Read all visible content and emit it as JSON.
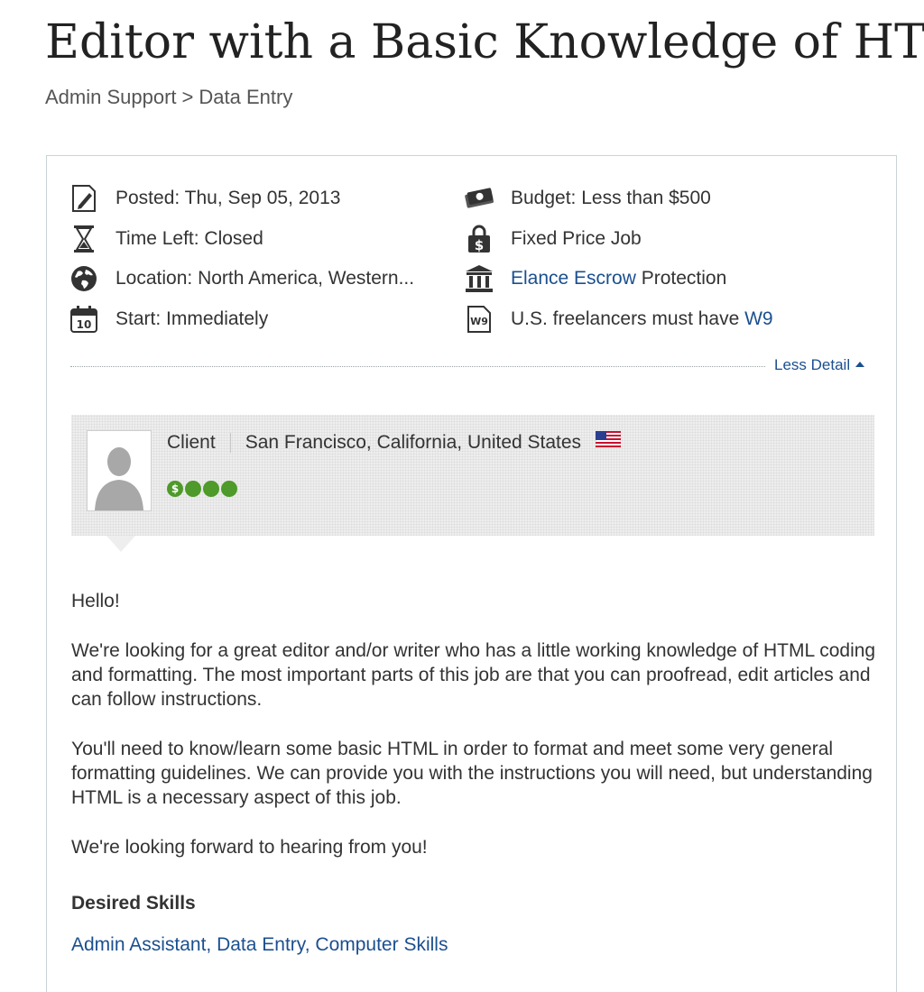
{
  "job": {
    "title": "Editor with a Basic Knowledge of HTML",
    "breadcrumb": {
      "category": "Admin Support",
      "separator": ">",
      "subcategory": "Data Entry"
    }
  },
  "meta": {
    "posted": {
      "icon": "pencil-paper-icon",
      "text": "Posted: Thu, Sep 05, 2013"
    },
    "time_left": {
      "icon": "hourglass-icon",
      "text": "Time Left: Closed"
    },
    "location": {
      "icon": "globe-icon",
      "text": "Location: North America, Western..."
    },
    "start": {
      "icon": "calendar-icon",
      "calendar_day": "10",
      "text": "Start: Immediately"
    },
    "budget": {
      "icon": "money-icon",
      "text": "Budget: Less than $500"
    },
    "job_type": {
      "icon": "money-lock-icon",
      "text": "Fixed Price Job"
    },
    "escrow": {
      "icon": "bank-icon",
      "link_text": "Elance Escrow",
      "text": " Protection"
    },
    "w9": {
      "icon": "w9-icon",
      "icon_text": "W9",
      "text": "U.S. freelancers must have ",
      "link_text": "W9"
    }
  },
  "less_detail_label": "Less Detail",
  "client": {
    "label": "Client",
    "location": "San Francisco, California, United States",
    "flag_icon": "us-flag-icon",
    "rating_icon_text": "$"
  },
  "description": {
    "greeting": "Hello!",
    "paragraph_1": "We're looking for a great editor and/or writer who has a little working knowledge of HTML coding and formatting. The most important parts of this job are that you can proofread, edit articles and can follow instructions.",
    "paragraph_2": "You'll need to know/learn some basic HTML in order to format and meet some very general formatting guidelines. We can provide you with the instructions you will need, but understanding HTML is a necessary aspect of this job.",
    "closing": "We're looking forward to hearing from you!"
  },
  "skills": {
    "heading": "Desired Skills",
    "items": [
      "Admin Assistant",
      "Data Entry",
      "Computer Skills"
    ],
    "separator": ", "
  },
  "colors": {
    "link": "#1b4f8f",
    "rating_green": "#4e9a2a",
    "panel_border": "#c9d3d6"
  }
}
